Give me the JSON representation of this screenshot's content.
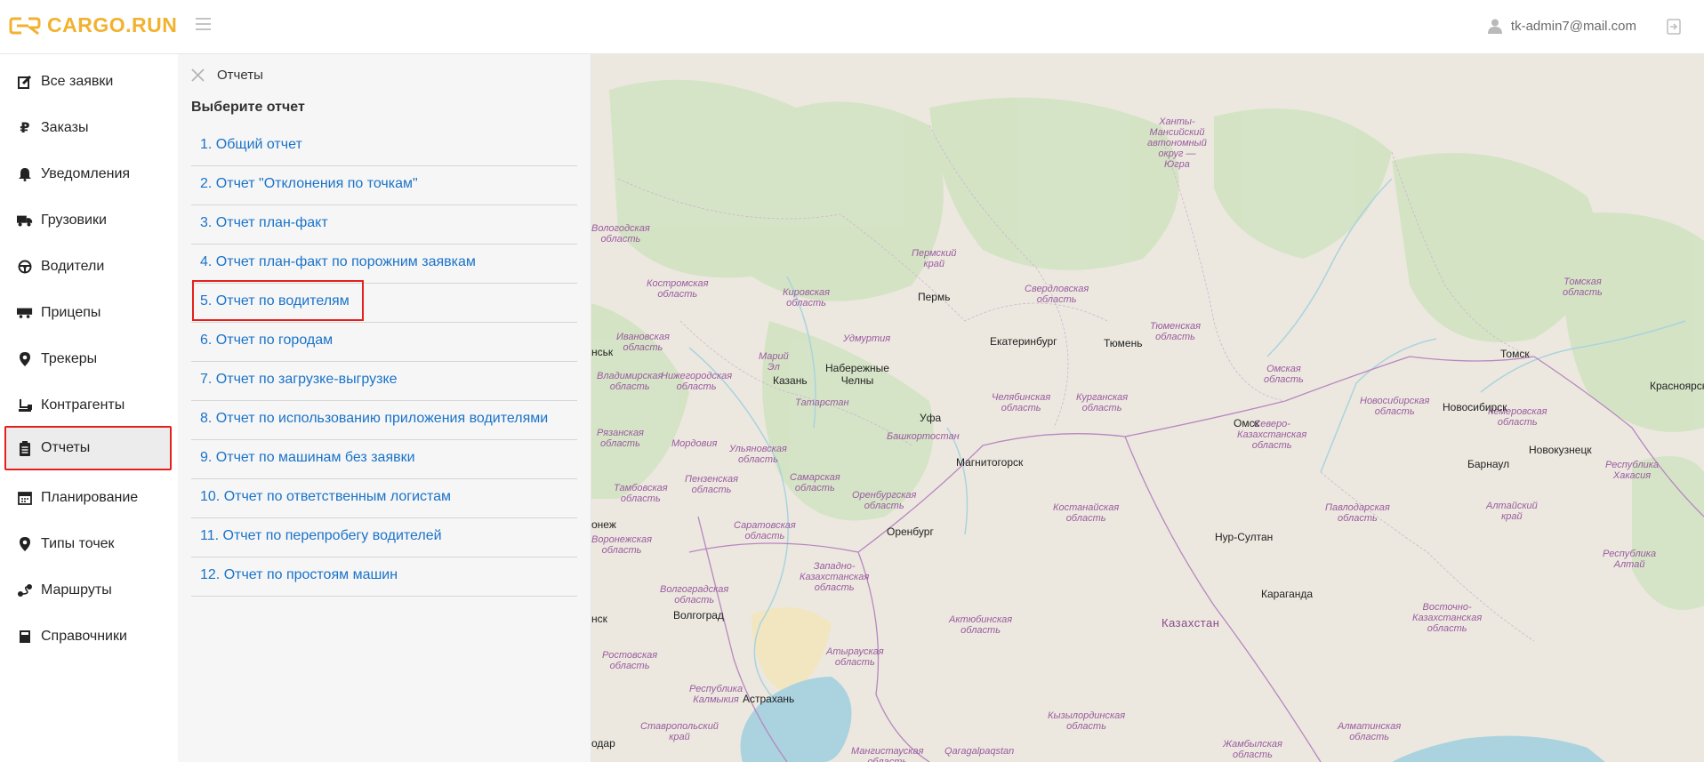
{
  "app": {
    "logo_text": "CARGO.RUN",
    "brand_color": "#f2b230"
  },
  "header": {
    "user_email": "tk-admin7@mail.com"
  },
  "sidebar": {
    "items": [
      {
        "label": "Все заявки",
        "icon": "edit-icon"
      },
      {
        "label": "Заказы",
        "icon": "ruble-icon"
      },
      {
        "label": "Уведомления",
        "icon": "bell-icon"
      },
      {
        "label": "Грузовики",
        "icon": "truck-icon"
      },
      {
        "label": "Водители",
        "icon": "steering-wheel-icon"
      },
      {
        "label": "Прицепы",
        "icon": "trailer-icon"
      },
      {
        "label": "Трекеры",
        "icon": "map-marker-icon"
      },
      {
        "label": "Контрагенты",
        "icon": "sitemap-icon"
      },
      {
        "label": "Отчеты",
        "icon": "clipboard-icon",
        "active": true
      },
      {
        "label": "Планирование",
        "icon": "calendar-icon"
      },
      {
        "label": "Типы точек",
        "icon": "map-marker-icon"
      },
      {
        "label": "Маршруты",
        "icon": "route-icon"
      },
      {
        "label": "Справочники",
        "icon": "book-icon"
      }
    ]
  },
  "reports_panel": {
    "title": "Отчеты",
    "subtitle": "Выберите отчет",
    "items": [
      "1. Общий отчет",
      "2. Отчет \"Отклонения по точкам\"",
      "3. Отчет план-факт",
      "4. Отчет план-факт по порожним заявкам",
      "5. Отчет по водителям",
      "6. Отчет по городам",
      "7. Отчет по загрузке-выгрузке",
      "8. Отчет по использованию приложения водителями",
      "9. Отчет по машинам без заявки",
      "10. Отчет по ответственным логистам",
      "11. Отчет по перепробегу водителей",
      "12. Отчет по простоям машин"
    ],
    "highlighted_index": 4
  },
  "map": {
    "regions": [
      "Ханты-\nМансийский\nавтономный\nокруг —\nЮгра",
      "Вологодская\nобласть",
      "Костромская\nобласть",
      "Пермский\nкрай",
      "Кировская\nобласть",
      "Свердловская\nобласть",
      "Тюменская\nобласть",
      "Томская\nобласть",
      "Ивановская\nобласть",
      "Удмуртия",
      "Марий\nЭл",
      "Владимирская\nобласть",
      "Нижегородская\nобласть",
      "Омская\nобласть",
      "Татарстан",
      "Челябинская\nобласть",
      "Курганская\nобласть",
      "Новосибирская\nобласть",
      "Кемеровская\nобласть",
      "Рязанская\nобласть",
      "Мордовия",
      "Ульяновская\nобласть",
      "Башкортостан",
      "Северо-\nКазахстанская\nобласть",
      "Пензенская\nобласть",
      "Самарская\nобласть",
      "Республика\nХакасия",
      "Тамбовская\nобласть",
      "Оренбургская\nобласть",
      "Костанайская\nобласть",
      "Павлодарская\nобласть",
      "Алтайский\nкрай",
      "Саратовская\nобласть",
      "Воронежская\nобласть",
      "Республика\nАлтай",
      "Западно-\nКазахстанская\nобласть",
      "Волгоградская\nобласть",
      "Актюбинская\nобласть",
      "Восточно-\nКазахстанская\nобласть",
      "Атырауская\nобласть",
      "Ростовская\nобласть",
      "Республика\nКалмыкия",
      "Ставропольский\nкрай",
      "Мангистауская\nобласть",
      "Кызылординская\nобласть",
      "Алматинская\nобласть",
      "Жамбылская\nобласть",
      "Qaragalpaqstan"
    ],
    "cities": [
      "Пермь",
      "Екатеринбург",
      "Тюмень",
      "Томск",
      "Красноярск",
      "Казань",
      "Набережные\nЧелны",
      "Уфа",
      "Омск",
      "Новосибирск",
      "Новокузнецк",
      "Магнитогорск",
      "Барнаул",
      "Оренбург",
      "Нур-Султан",
      "Караганда",
      "Волгоград",
      "Астрахань",
      "нск",
      "онеж",
      "нськ",
      "одар"
    ],
    "country": "Казахстан",
    "colors": {
      "land": "#ece8df",
      "forest": "#d6e5c6",
      "water": "#aad3df",
      "border": "#b886c0"
    }
  }
}
